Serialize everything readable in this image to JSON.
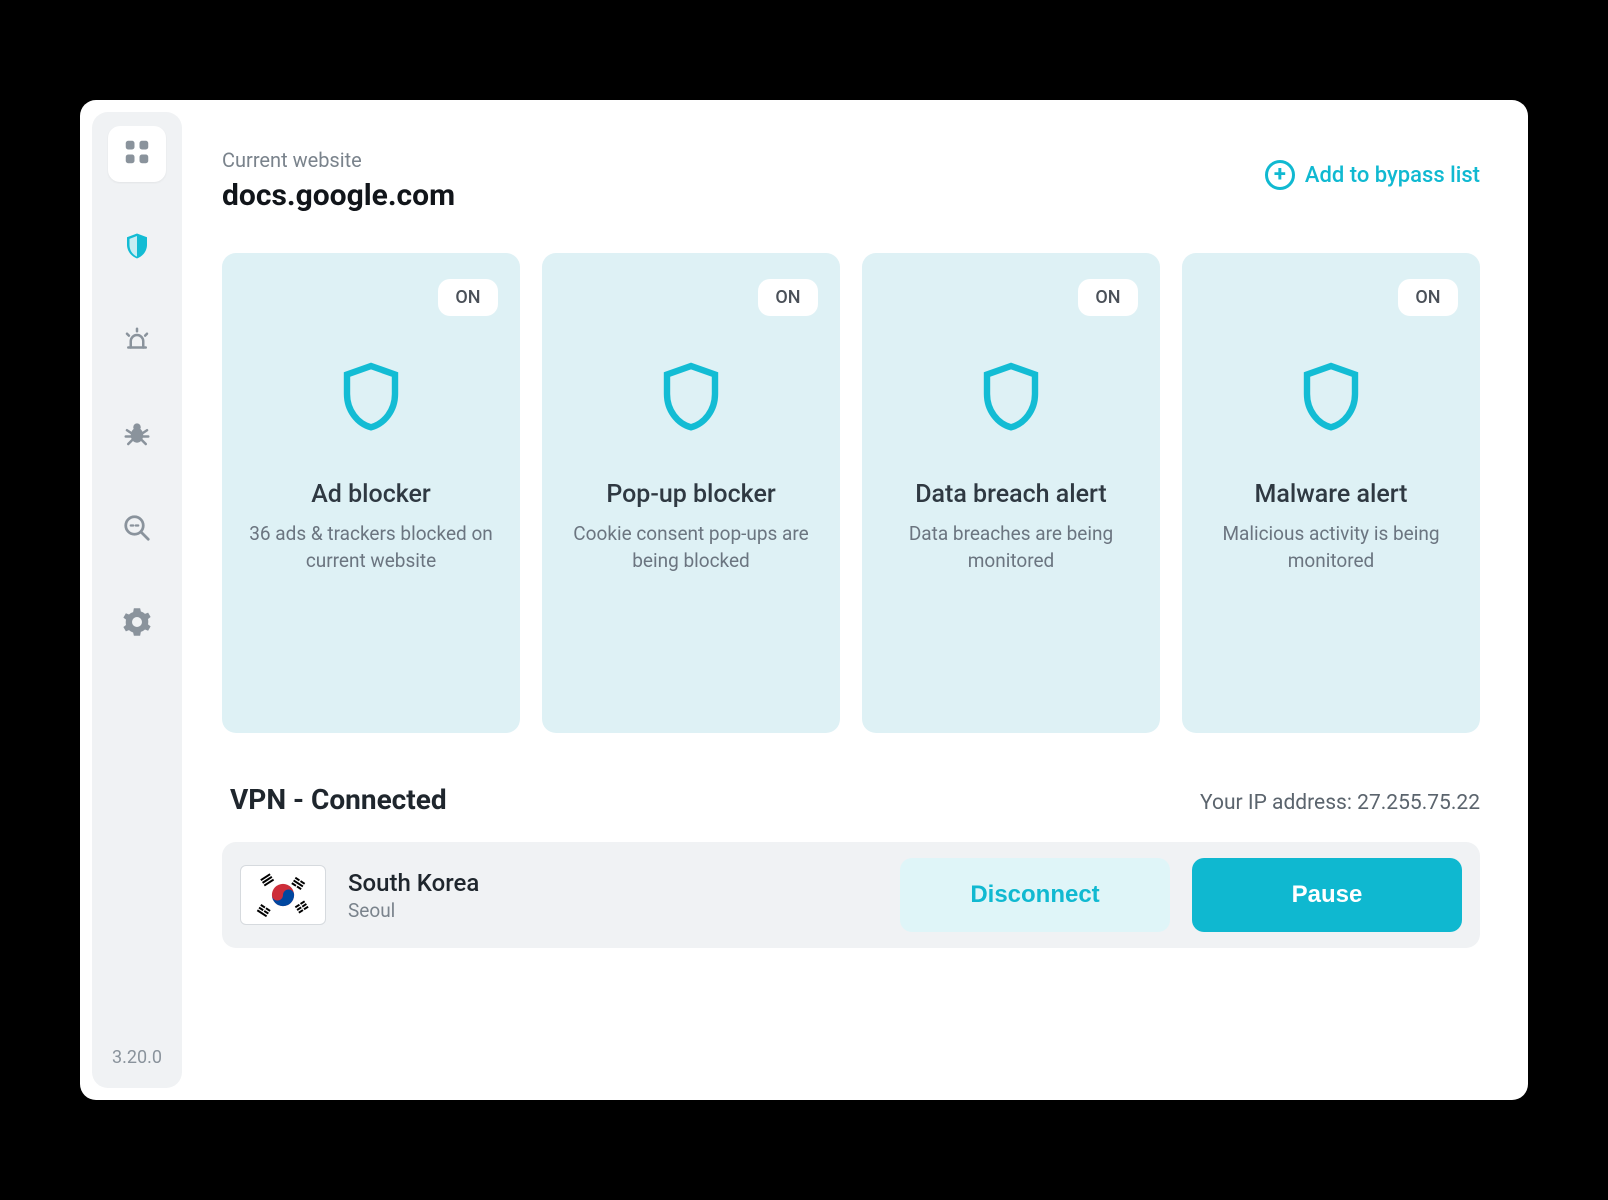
{
  "header": {
    "current_website_label": "Current website",
    "current_website_host": "docs.google.com",
    "bypass_link_label": "Add to bypass list"
  },
  "sidebar": {
    "version": "3.20.0"
  },
  "cards": [
    {
      "status": "ON",
      "title": "Ad blocker",
      "desc": "36 ads & trackers blocked on current website"
    },
    {
      "status": "ON",
      "title": "Pop-up blocker",
      "desc": "Cookie consent pop-ups are being blocked"
    },
    {
      "status": "ON",
      "title": "Data breach alert",
      "desc": "Data breaches are being monitored"
    },
    {
      "status": "ON",
      "title": "Malware alert",
      "desc": "Malicious activity is being monitored"
    }
  ],
  "vpn": {
    "title": "VPN - Connected",
    "ip_label": "Your IP address: 27.255.75.22",
    "country": "South Korea",
    "city": "Seoul",
    "disconnect_label": "Disconnect",
    "pause_label": "Pause"
  },
  "colors": {
    "accent": "#10b9d1",
    "card_bg": "#def1f5",
    "sidebar_bg": "#f0f2f4"
  }
}
